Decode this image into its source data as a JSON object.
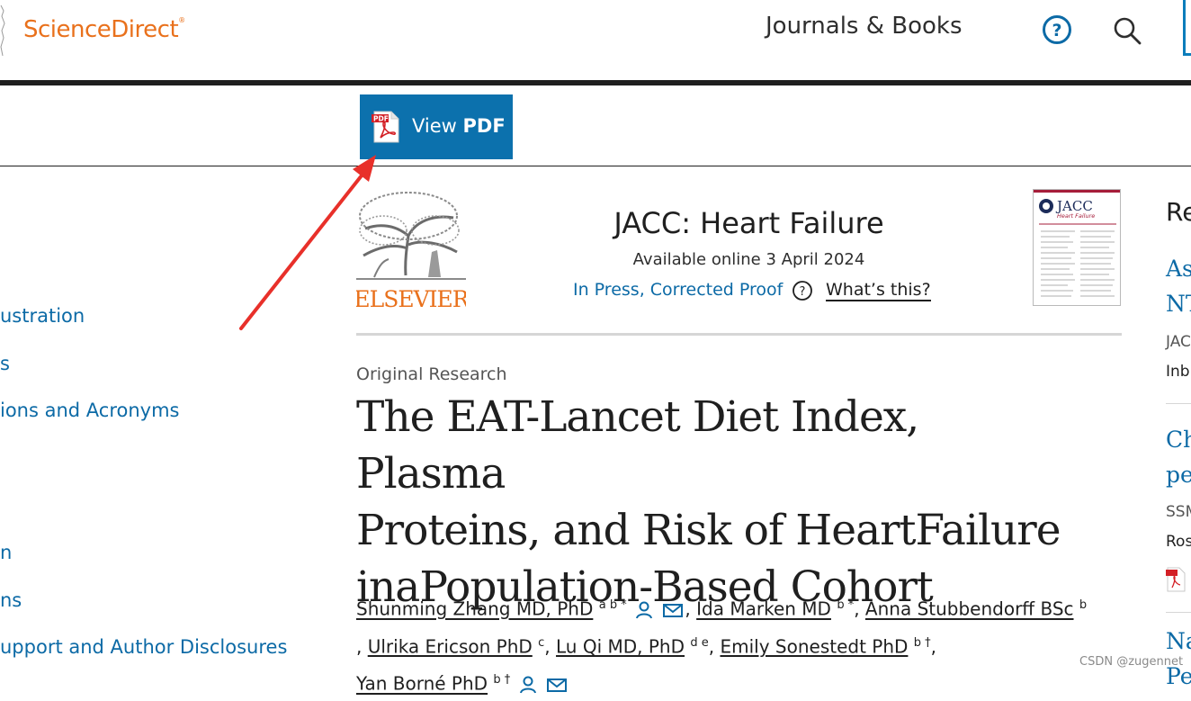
{
  "header": {
    "logo_text": "ScienceDirect",
    "logo_trademark": "®",
    "nav_journals": "Journals & Books",
    "help_icon": "question-circle-icon",
    "search_icon": "search-icon"
  },
  "toolbar": {
    "view_label": "View",
    "pdf_label": "PDF"
  },
  "outline": [
    "ustration",
    "s",
    "ions and Acronyms",
    "n",
    "ns",
    "upport and Author Disclosures"
  ],
  "publication": {
    "publisher_logo_text": "ELSEVIER",
    "journal_title": "JACC: Heart Failure",
    "available": "Available online 3 April 2024",
    "status": "In Press, Corrected Proof",
    "whats_this": "What’s this?",
    "cover_title_1": "JACC",
    "cover_title_2": "Heart Failure"
  },
  "article": {
    "type": "Original Research",
    "title_lines": [
      "The EAT-Lancet Diet Index, Plasma",
      "Proteins, and Risk of HeartFailure",
      "inaPopulation-Based Cohort"
    ],
    "authors": [
      {
        "name": "Shunming Zhang MD, PhD",
        "sup": "a b *"
      },
      {
        "name": "Ida Marken MD",
        "sup": "b *"
      },
      {
        "name": "Anna Stubbendorff BSc",
        "sup": "b"
      },
      {
        "name": "Ulrika Ericson PhD",
        "sup": "c"
      },
      {
        "name": "Lu Qi MD, PhD",
        "sup": "d e"
      },
      {
        "name": "Emily Sonestedt PhD",
        "sup": "b †"
      },
      {
        "name": "Yan Borné PhD",
        "sup": "b †"
      }
    ]
  },
  "rail": {
    "title": "Re",
    "item1_line1": "Asy",
    "item1_line2": "NT",
    "item1_journal": "JAC",
    "item1_authors": "Inb",
    "item2_line1": "Ch",
    "item2_line2": "pe",
    "item2_journal": "SSM",
    "item2_authors": "Ros",
    "item3_line1": "Na",
    "item3_line2": "Pe"
  },
  "watermark": "CSDN @zugennet",
  "colors": {
    "brand_orange": "#e9711c",
    "link_blue": "#0c6aa6",
    "pdf_button": "#0c71ad",
    "annotation_red": "#e8302a"
  }
}
